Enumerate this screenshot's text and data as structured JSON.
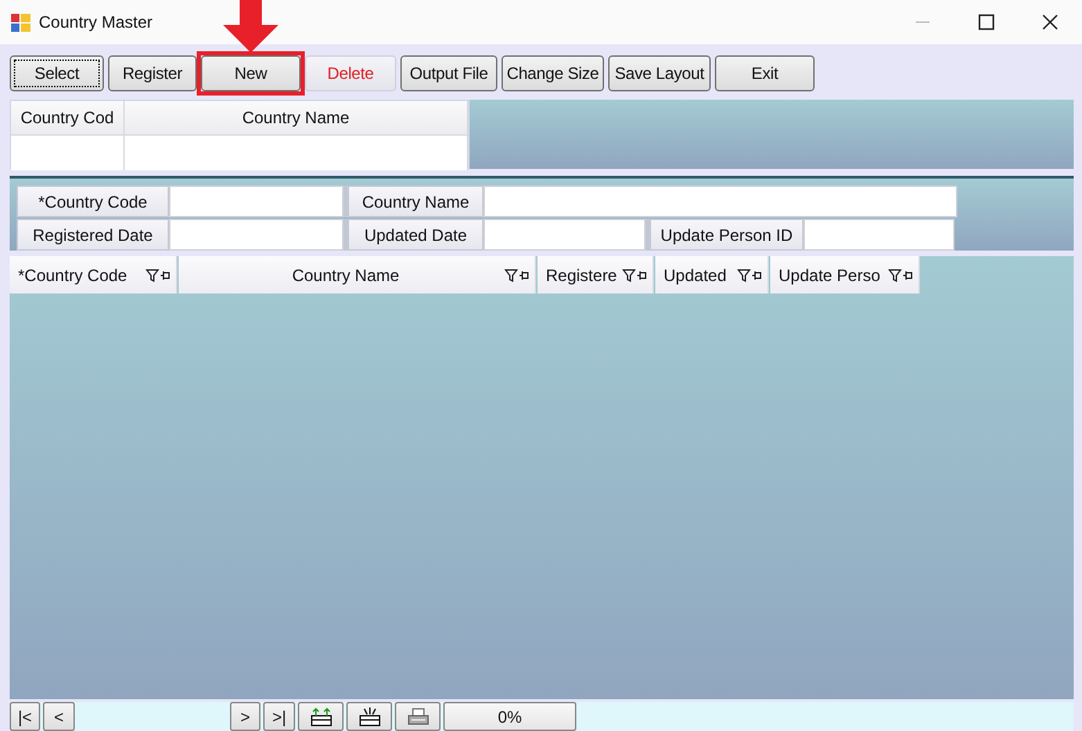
{
  "window": {
    "title": "Country Master"
  },
  "toolbar": [
    {
      "label": "Select",
      "kind": "focused",
      "highlighted": false
    },
    {
      "label": "Register",
      "kind": "normal",
      "highlighted": false
    },
    {
      "label": "New",
      "kind": "normal",
      "highlighted": true
    },
    {
      "label": "Delete",
      "kind": "danger",
      "highlighted": false
    },
    {
      "label": "Output File",
      "kind": "normal",
      "highlighted": false
    },
    {
      "label": "Change Size",
      "kind": "normal",
      "highlighted": false
    },
    {
      "label": "Save Layout",
      "kind": "normal",
      "highlighted": false
    },
    {
      "label": "Exit",
      "kind": "normal",
      "highlighted": false
    }
  ],
  "search_grid": {
    "columns": [
      "Country Cod",
      "Country Name"
    ]
  },
  "form": {
    "rows": [
      [
        "*Country Code",
        "Country Name"
      ],
      [
        "Registered Date",
        "Updated Date",
        "Update Person ID"
      ]
    ]
  },
  "grid": {
    "columns": [
      "*Country Code",
      "Country Name",
      "Registere",
      "Updated",
      "Update Perso"
    ]
  },
  "navigator": {
    "buttons": [
      "|<",
      "<",
      ">",
      ">|"
    ],
    "progress": "0%"
  }
}
